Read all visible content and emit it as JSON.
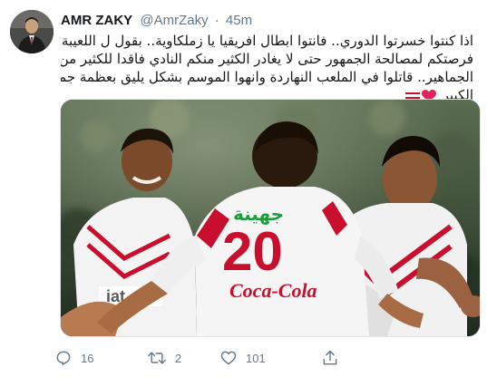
{
  "tweet": {
    "display_name": "AMR ZAKY",
    "handle": "@AmrZaky",
    "separator": "·",
    "time": "45m",
    "text_lines": [
      "اذا كنتوا خسرتوا الدوري.. فانتوا ابطال افريقيا يا زملكاوية.. بقول ل اللعيبة.. النهاردة",
      "فرصتكم لمصالحة الجمهور حتى لا يغادر الكثير منكم النادي فاقدا للكثير من تعاطف",
      "الجماهير.. قاتلوا في الملعب النهاردة وانهوا الموسم بشكل يليق بعظمة جمهور الزمالك",
      "الكبير"
    ],
    "media": {
      "jersey_number": "20",
      "jersey_sponsor": "Coca-Cola",
      "jersey_sponsor_ar": "جهينة",
      "jersey_partial_text": "iat"
    }
  },
  "actions": {
    "reply_count": "16",
    "retweet_count": "2",
    "like_count": "101"
  },
  "icons": {
    "reply": "reply-icon",
    "retweet": "retweet-icon",
    "like": "heart-icon",
    "share": "share-icon"
  },
  "colors": {
    "secondary_text": "#657786",
    "heart_emoji": "#e0245e",
    "flag_red": "#c8102e"
  }
}
